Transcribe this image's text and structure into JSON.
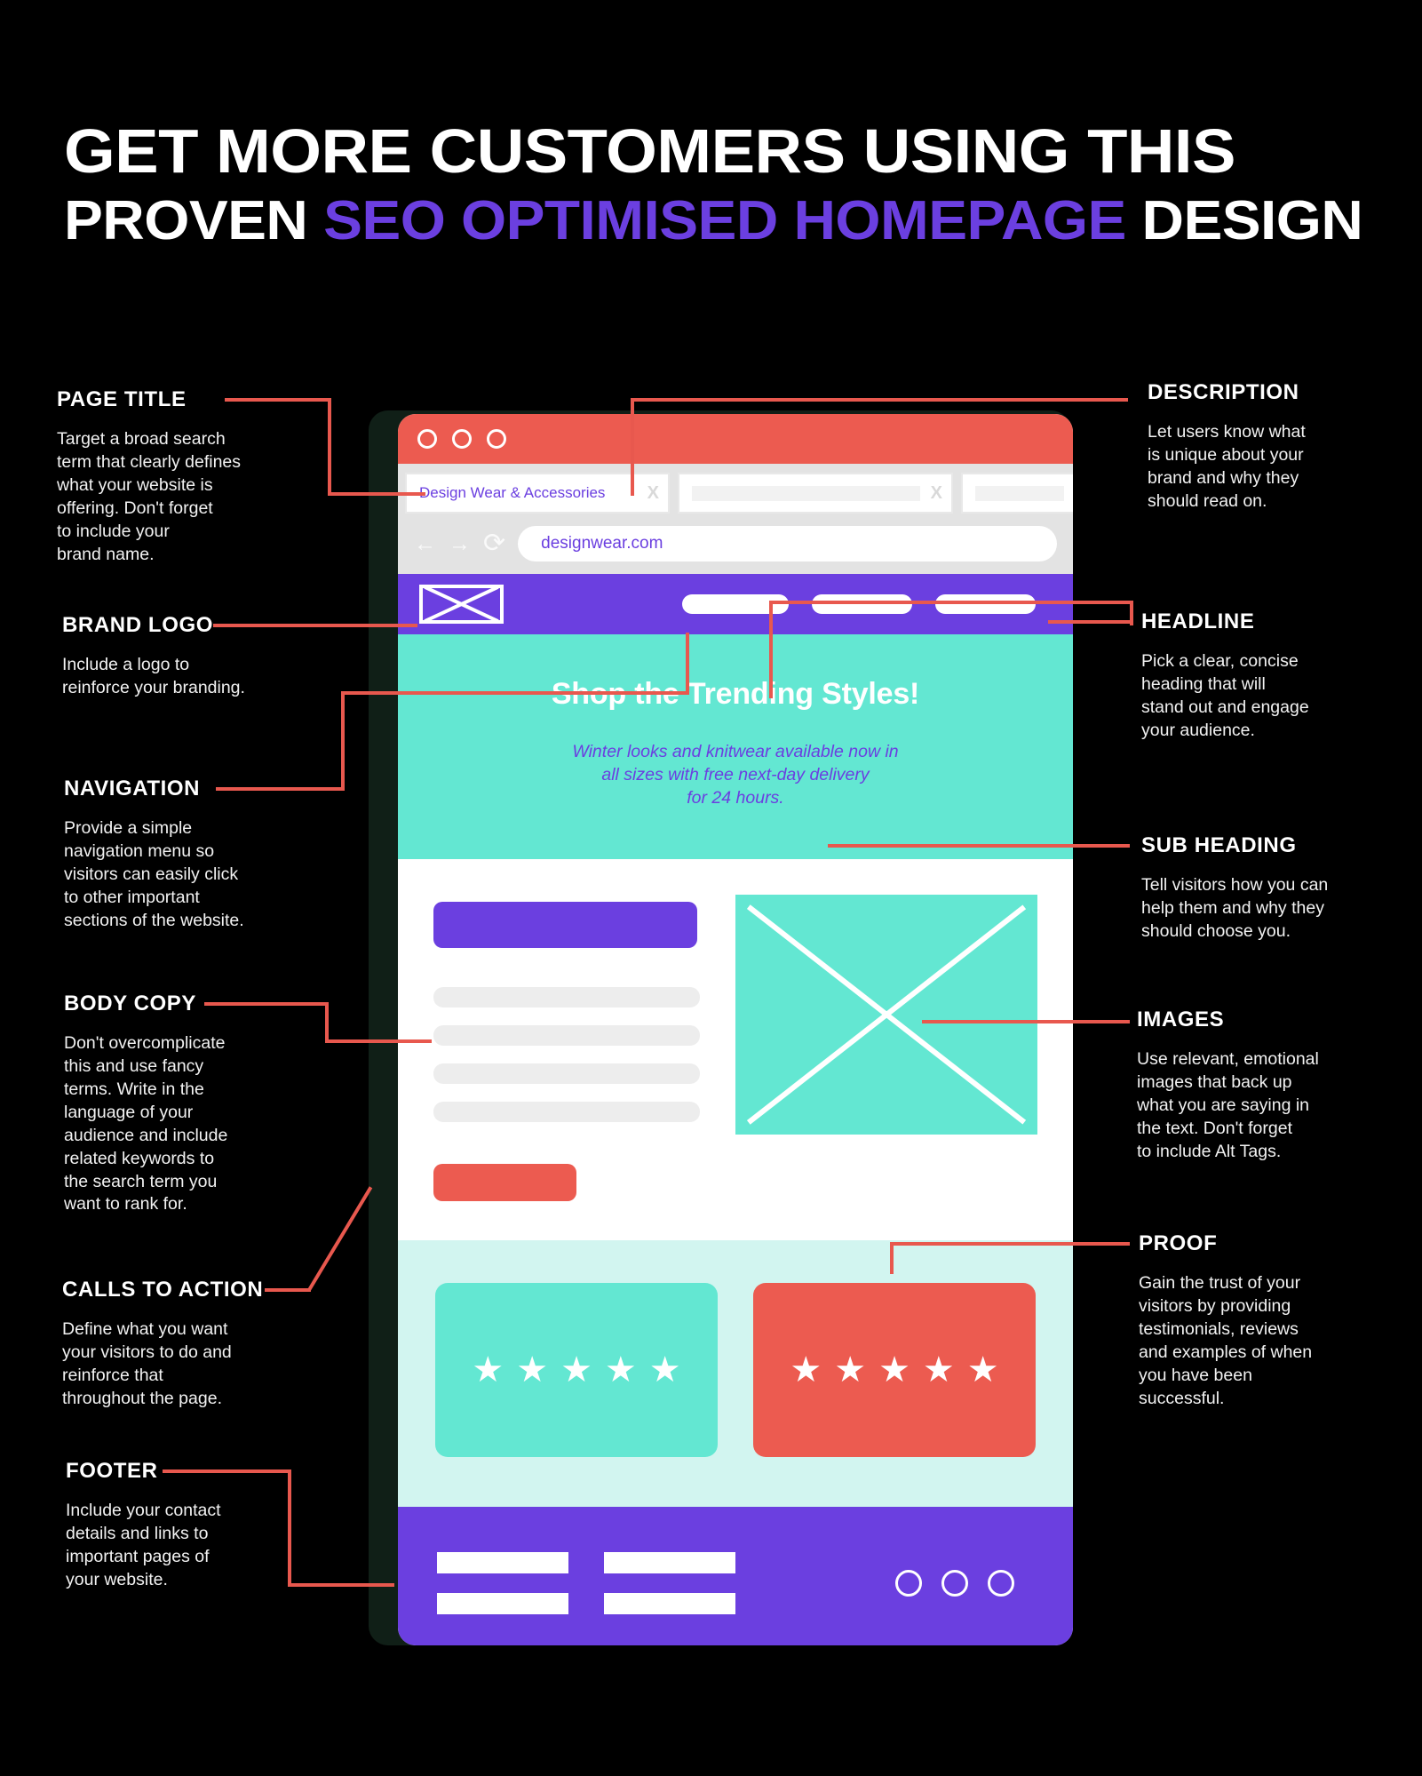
{
  "title": {
    "line1": "GET MORE CUSTOMERS USING THIS",
    "line2_pre": "PROVEN ",
    "line2_accent": "SEO OPTIMISED HOMEPAGE",
    "line2_post": " DESIGN"
  },
  "colors": {
    "background": "#000000",
    "accent_purple": "#6b3fe0",
    "accent_red": "#ec5b50",
    "accent_teal": "#63e7d2",
    "connector_red": "#e8584e",
    "pale_teal": "#d2f5f0"
  },
  "annotations": {
    "page_title": {
      "heading": "PAGE TITLE",
      "body": [
        "Target a broad search",
        "term that clearly defines",
        "what your website is",
        "offering. Don't forget",
        "to include your",
        "brand name."
      ]
    },
    "brand_logo": {
      "heading": "BRAND LOGO",
      "body": [
        "Include a logo to",
        "reinforce your branding."
      ]
    },
    "navigation": {
      "heading": "NAVIGATION",
      "body": [
        "Provide a simple",
        "navigation menu so",
        "visitors can easily click",
        "to other important",
        "sections of the website."
      ]
    },
    "body_copy": {
      "heading": "BODY COPY",
      "body": [
        "Don't overcomplicate",
        "this and use fancy",
        "terms. Write in the",
        "language of your",
        "audience and include",
        "related keywords to",
        "the search term you",
        "want to rank for."
      ]
    },
    "calls_to_action": {
      "heading": "CALLS TO ACTION",
      "body": [
        "Define what you want",
        "your visitors to do and",
        "reinforce that",
        "throughout the page."
      ]
    },
    "footer": {
      "heading": "FOOTER",
      "body": [
        "Include your contact",
        "details and links to",
        "important pages of",
        "your website."
      ]
    },
    "description": {
      "heading": "DESCRIPTION",
      "body": [
        "Let users know what",
        "is unique about your",
        "brand and why they",
        "should read on."
      ]
    },
    "headline": {
      "heading": "HEADLINE",
      "body": [
        "Pick a clear, concise",
        "heading that will",
        "stand out and engage",
        "your audience."
      ]
    },
    "sub_heading": {
      "heading": "SUB HEADING",
      "body": [
        "Tell visitors how you can",
        "help them and why they",
        "should choose you."
      ]
    },
    "images": {
      "heading": "IMAGES",
      "body": [
        "Use relevant, emotional",
        "images that back up",
        "what you are saying in",
        "the text. Don't forget",
        "to include Alt Tags."
      ]
    },
    "proof": {
      "heading": "PROOF",
      "body": [
        "Gain the trust of your",
        "visitors by providing",
        "testimonials, reviews",
        "and examples of when",
        "you have been",
        "successful."
      ]
    }
  },
  "browser": {
    "window_controls": [
      "close-dot",
      "minimize-dot",
      "maximize-dot"
    ],
    "tabs": [
      {
        "label": "Design Wear & Accessories",
        "close": "X",
        "active": true
      },
      {
        "label": "",
        "close": "X",
        "active": false
      },
      {
        "label": "",
        "close": "",
        "active": false
      }
    ],
    "nav": {
      "back_icon": "←",
      "forward_icon": "→",
      "reload_icon": "⟳",
      "url": "designwear.com"
    },
    "site": {
      "logo_alt": "brand-logo-placeholder",
      "nav_items": [
        "nav-link-1",
        "nav-link-2",
        "nav-link-3"
      ],
      "hero_headline": "Shop the Trending Styles!",
      "hero_sub": [
        "Winter looks and knitwear available now in",
        "all sizes with free next-day delivery",
        "for 24 hours."
      ],
      "body_heading_block": "heading-placeholder",
      "body_text_lines": 4,
      "cta_label": "cta-button-placeholder",
      "image_placeholder": "hero-image-placeholder",
      "testimonials": [
        {
          "stars": 5,
          "color": "teal"
        },
        {
          "stars": 5,
          "color": "red"
        }
      ],
      "footer": {
        "columns": [
          [
            "footer-link-1",
            "footer-link-2"
          ],
          [
            "footer-link-3",
            "footer-link-4"
          ]
        ],
        "social": [
          "social-icon-1",
          "social-icon-2",
          "social-icon-3"
        ]
      }
    }
  }
}
